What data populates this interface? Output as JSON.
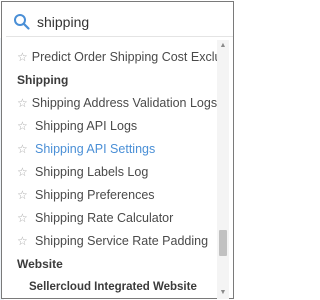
{
  "search": {
    "value": "shipping",
    "icon": "search-icon",
    "accent_color": "#4a8fd6"
  },
  "menu": {
    "rows": [
      {
        "type": "item",
        "label": "Predict Order Shipping Cost Exclusion",
        "starred": false
      },
      {
        "type": "header",
        "label": "Shipping"
      },
      {
        "type": "item",
        "label": "Shipping Address Validation Logs",
        "starred": false
      },
      {
        "type": "item",
        "label": "Shipping API Logs",
        "starred": false
      },
      {
        "type": "item",
        "label": "Shipping API Settings",
        "starred": false,
        "highlighted": true
      },
      {
        "type": "item",
        "label": "Shipping Labels Log",
        "starred": false
      },
      {
        "type": "item",
        "label": "Shipping Preferences",
        "starred": false
      },
      {
        "type": "item",
        "label": "Shipping Rate Calculator",
        "starred": false
      },
      {
        "type": "item",
        "label": "Shipping Service Rate Padding",
        "starred": false
      },
      {
        "type": "header",
        "label": "Website"
      },
      {
        "type": "subheader",
        "label": "Sellercloud Integrated Website"
      }
    ],
    "star_icon": "star-outline-icon",
    "highlight_color": "#4a8fd6"
  },
  "scrollbar": {
    "position_fraction": 0.85
  }
}
